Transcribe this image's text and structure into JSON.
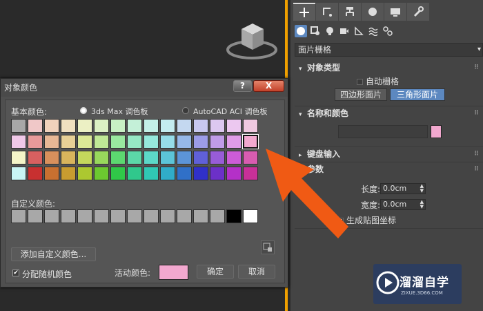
{
  "viewport": {},
  "panel": {
    "dropdown_value": "面片栅格",
    "object_type": {
      "header": "对象类型",
      "auto_grid": "自动栅格",
      "buttons": [
        "四边形面片",
        "三角形面片"
      ]
    },
    "name_color": {
      "header": "名称和颜色",
      "swatch_color": "#f2a8cf"
    },
    "keyboard_input": {
      "header": "键盘输入"
    },
    "params": {
      "header": "参数",
      "length_label": "长度:",
      "length_value": "0.0cm",
      "width_label": "宽度:",
      "width_value": "0.0cm",
      "gen_mapping": "生成贴图坐标"
    }
  },
  "dialog": {
    "title": "对象颜色",
    "help": "?",
    "close": "X",
    "basic_colors_label": "基本颜色:",
    "palette_3ds": "3ds Max 调色板",
    "palette_acad": "AutoCAD ACI 调色板",
    "custom_colors_label": "自定义颜色:",
    "add_custom": "添加自定义颜色...",
    "random_label": "分配随机颜色",
    "active_color_label": "活动颜色:",
    "active_color": "#f2a8cf",
    "ok": "确定",
    "cancel": "取消",
    "basic_rows": [
      [
        "#a8a8a8",
        "#f0c8c8",
        "#f0d2bc",
        "#f0e0c0",
        "#ecf0c4",
        "#dcf0c4",
        "#c8f0c4",
        "#c4f0d8",
        "#c4f0e8",
        "#c4ecf0",
        "#c4d8f0",
        "#c8c8f0",
        "#dcc8f0",
        "#ecc8f0",
        "#f0c8e0"
      ],
      [
        "#f0c8e8",
        "#e89a9a",
        "#e8b896",
        "#e8d096",
        "#dce896",
        "#c0e896",
        "#9ae8a0",
        "#96e8c4",
        "#96e8dc",
        "#96dce8",
        "#96b8e8",
        "#9c9ce8",
        "#c09ce8",
        "#e09ce8",
        "#f2a8cf"
      ],
      [
        "#f4f4c8",
        "#d86060",
        "#d8905c",
        "#d8b45c",
        "#c4d85c",
        "#98d85c",
        "#5cd870",
        "#5cd8a8",
        "#5cd8c8",
        "#5cc4d8",
        "#5c94d8",
        "#6060d8",
        "#985cd8",
        "#cc5cd8",
        "#d85cb0"
      ],
      [
        "#c8f4f4",
        "#c83030",
        "#c87030",
        "#c89c30",
        "#acc830",
        "#6cc830",
        "#30c848",
        "#30c88c",
        "#30c8b4",
        "#30acc8",
        "#3070c8",
        "#3030c8",
        "#6c30c8",
        "#b430c8",
        "#c83098"
      ]
    ],
    "custom_row": [
      "#a8a8a8",
      "#a8a8a8",
      "#a8a8a8",
      "#a8a8a8",
      "#a8a8a8",
      "#a8a8a8",
      "#a8a8a8",
      "#a8a8a8",
      "#a8a8a8",
      "#a8a8a8",
      "#a8a8a8",
      "#a8a8a8",
      "#a8a8a8",
      "#000000",
      "#ffffff"
    ]
  },
  "watermark": {
    "name": "溜溜自学",
    "url": "ZIXUE.3D66.COM"
  }
}
